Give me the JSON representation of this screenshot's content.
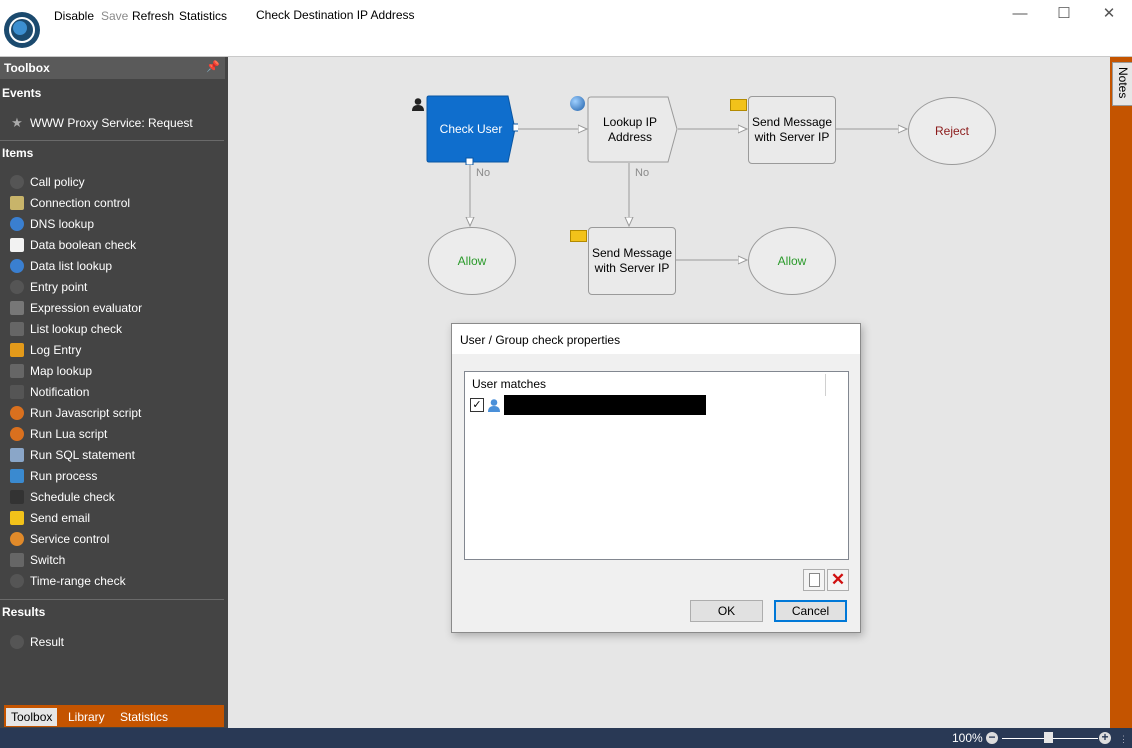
{
  "toolbar": {
    "disable_label": "Disable",
    "save_label": "Save",
    "refresh_label": "Refresh",
    "statistics_label": "Statistics"
  },
  "window": {
    "title": "Check Destination IP Address"
  },
  "toolbox": {
    "title": "Toolbox",
    "events_heading": "Events",
    "events": [
      {
        "label": "WWW Proxy Service: Request",
        "icon": "star-icon"
      }
    ],
    "items_heading": "Items",
    "items": [
      {
        "label": "Call policy",
        "icon": "call-policy-icon",
        "color": "#555555"
      },
      {
        "label": "Connection control",
        "icon": "connection-control-icon",
        "color": "#c8b46a"
      },
      {
        "label": "DNS lookup",
        "icon": "globe-icon",
        "color": "#3a7fd0"
      },
      {
        "label": "Data boolean check",
        "icon": "boolean-check-icon",
        "color": "#f2f2f2"
      },
      {
        "label": "Data list lookup",
        "icon": "globe-list-icon",
        "color": "#3a7fd0"
      },
      {
        "label": "Entry point",
        "icon": "entry-point-icon",
        "color": "#555555"
      },
      {
        "label": "Expression evaluator",
        "icon": "pen-icon",
        "color": "#777777"
      },
      {
        "label": "List lookup check",
        "icon": "list-icon",
        "color": "#666666"
      },
      {
        "label": "Log Entry",
        "icon": "log-icon",
        "color": "#e39a1a"
      },
      {
        "label": "Map lookup",
        "icon": "map-icon",
        "color": "#666666"
      },
      {
        "label": "Notification",
        "icon": "notification-icon",
        "color": "#555555"
      },
      {
        "label": "Run Javascript script",
        "icon": "gear-icon",
        "color": "#d9701e"
      },
      {
        "label": "Run Lua script",
        "icon": "gear-icon",
        "color": "#d9701e"
      },
      {
        "label": "Run SQL statement",
        "icon": "database-icon",
        "color": "#8aa6c8"
      },
      {
        "label": "Run process",
        "icon": "process-icon",
        "color": "#3a8ad0"
      },
      {
        "label": "Schedule check",
        "icon": "calendar-icon",
        "color": "#333333"
      },
      {
        "label": "Send email",
        "icon": "envelope-icon",
        "color": "#f2c21a"
      },
      {
        "label": "Service control",
        "icon": "service-gear-icon",
        "color": "#e08a2a"
      },
      {
        "label": "Switch",
        "icon": "switch-icon",
        "color": "#666666"
      },
      {
        "label": "Time-range check",
        "icon": "clock-icon",
        "color": "#555555"
      }
    ],
    "results_heading": "Results",
    "results": [
      {
        "label": "Result",
        "icon": "result-icon",
        "color": "#555555"
      }
    ],
    "tabs": [
      {
        "label": "Toolbox",
        "active": true
      },
      {
        "label": "Library",
        "active": false
      },
      {
        "label": "Statistics",
        "active": false
      }
    ]
  },
  "notes": {
    "label": "Notes"
  },
  "flow": {
    "check_user": "Check User",
    "lookup_ip": "Lookup IP Address",
    "send_message_1": "Send Message with Server IP",
    "reject": "Reject",
    "allow_1": "Allow",
    "send_message_2": "Send Message with Server IP",
    "allow_2": "Allow",
    "no_label_1": "No",
    "no_label_2": "No"
  },
  "dialog": {
    "title": "User / Group check properties",
    "list_header": "User matches",
    "row_checked": true,
    "ok_label": "OK",
    "cancel_label": "Cancel"
  },
  "status": {
    "zoom": "100%"
  },
  "colors": {
    "accent": "#c45400",
    "selected_node": "#0f6ecd",
    "statusbar": "#293955",
    "reject_text": "#8b1a1a",
    "allow_text": "#2a9a2a"
  }
}
